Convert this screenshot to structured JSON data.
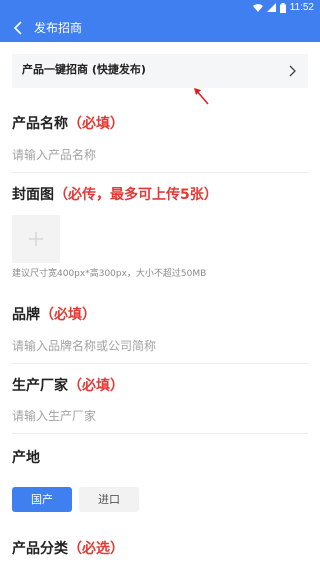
{
  "statusbar": {
    "time": "11:52"
  },
  "appbar": {
    "title": "发布招商"
  },
  "quick_publish": {
    "label": "产品一键招商 (快捷发布)"
  },
  "product_name": {
    "label": "产品名称",
    "required": "（必填）",
    "placeholder": "请输入产品名称"
  },
  "cover": {
    "label": "封面图",
    "required": "（必传，最多可上传5张）",
    "hint": "建议尺寸宽400px*高300px，大小不超过50MB"
  },
  "brand": {
    "label": "品牌",
    "required": "（必填）",
    "placeholder": "请输入品牌名称或公司简称"
  },
  "manufacturer": {
    "label": "生产厂家",
    "required": "（必填）",
    "placeholder": "请输入生产厂家"
  },
  "origin": {
    "label": "产地",
    "options": [
      "国产",
      "进口"
    ],
    "selected": "国产"
  },
  "category": {
    "label": "产品分类",
    "required": "（必选）"
  },
  "colors": {
    "primary": "#3f7ff0",
    "required": "#e53935"
  }
}
